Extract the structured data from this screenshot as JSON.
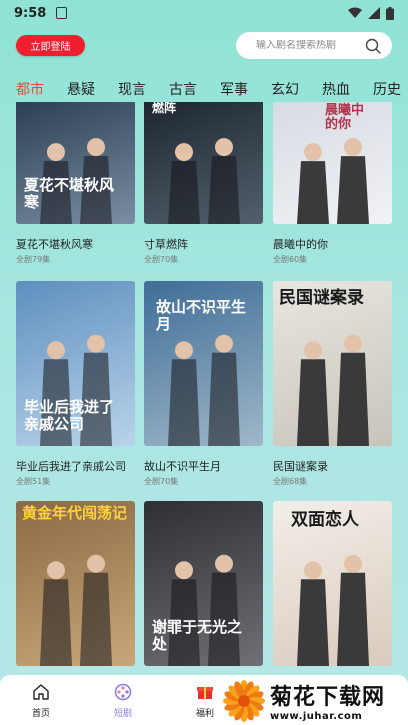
{
  "status_bar": {
    "time": "9:58"
  },
  "header": {
    "login_label": "立即登陆",
    "search": {
      "placeholder": "输入剧名搜索热剧"
    }
  },
  "tabs": [
    {
      "label": "都市",
      "active": true
    },
    {
      "label": "悬疑",
      "active": false
    },
    {
      "label": "现言",
      "active": false
    },
    {
      "label": "古言",
      "active": false
    },
    {
      "label": "军事",
      "active": false
    },
    {
      "label": "玄幻",
      "active": false
    },
    {
      "label": "热血",
      "active": false
    },
    {
      "label": "历史",
      "active": false
    }
  ],
  "dramas": [
    {
      "title": "夏花不堪秋风寒",
      "episodes": "全剧79集",
      "poster_text": "夏花不堪秋风寒",
      "colors": [
        "#2b3e52",
        "#7a8fa3"
      ]
    },
    {
      "title": "寸草燃阵",
      "episodes": "全剧70集",
      "poster_text": "燃阵",
      "colors": [
        "#1d2630",
        "#53606b"
      ]
    },
    {
      "title": "晨曦中的你",
      "episodes": "全剧60集",
      "poster_text": "晨曦中的你",
      "colors": [
        "#d7dbe2",
        "#f0f2f5"
      ]
    },
    {
      "title": "毕业后我进了亲戚公司",
      "episodes": "全剧51集",
      "poster_text": "毕业后我进了亲戚公司",
      "colors": [
        "#5e8fbf",
        "#b9d4ea"
      ]
    },
    {
      "title": "故山不识平生月",
      "episodes": "全剧70集",
      "poster_text": "故山不识平生月",
      "colors": [
        "#3f6d97",
        "#9fb8c8"
      ]
    },
    {
      "title": "民国谜案录",
      "episodes": "全剧68集",
      "poster_text": "民国谜案录",
      "colors": [
        "#e8e6e0",
        "#c9c4ba"
      ]
    },
    {
      "title": "",
      "episodes": "",
      "poster_text": "黄金年代闯荡记",
      "colors": [
        "#8a6a45",
        "#c9a77a"
      ]
    },
    {
      "title": "",
      "episodes": "",
      "poster_text": "谢罪于无光之处",
      "colors": [
        "#2e2f33",
        "#6f7075"
      ]
    },
    {
      "title": "",
      "episodes": "",
      "poster_text": "双面恋人",
      "colors": [
        "#f3eee9",
        "#d9cbbd"
      ]
    }
  ],
  "bottom_nav": [
    {
      "label": "首页",
      "icon": "home-icon",
      "active": false
    },
    {
      "label": "短剧",
      "icon": "film-reel-icon",
      "active": true
    },
    {
      "label": "福利",
      "icon": "gift-icon",
      "active": false
    }
  ],
  "watermark": {
    "name": "菊花下载网",
    "url": "www.juhar.com"
  },
  "colors": {
    "accent": "#e94a3d",
    "login_bg": "#f01f2f",
    "nav_active": "#8a7de8"
  }
}
